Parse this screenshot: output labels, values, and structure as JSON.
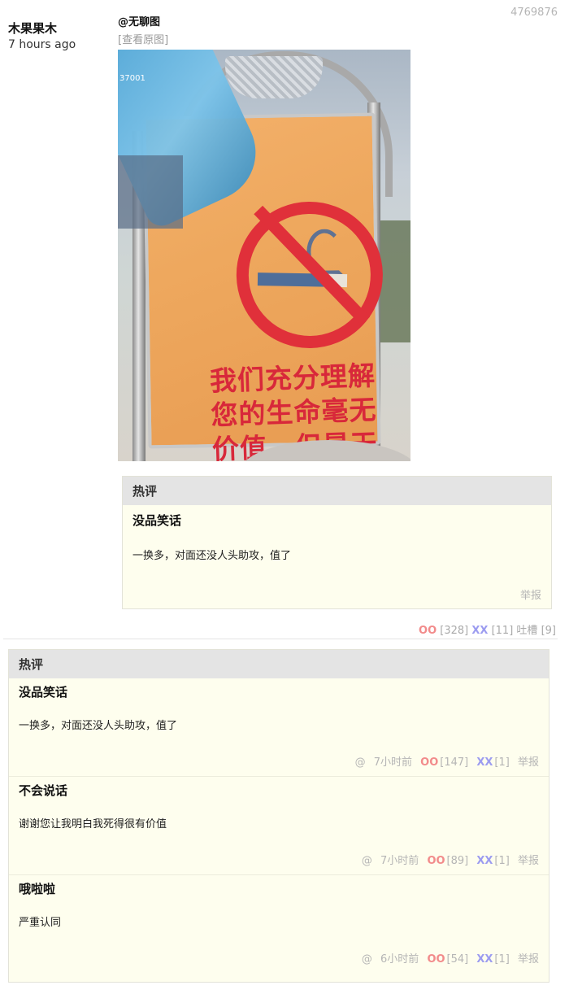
{
  "post": {
    "id": "4769876",
    "author": "木果果木",
    "time": "7 hours ago",
    "mention": "@无聊图",
    "view_original": "[查看原图]",
    "image_text": "我们充分理解您的生命毫无价值，但是天然气真的很贵",
    "image_watermark": "37001"
  },
  "hot_preview": {
    "header": "热评",
    "name": "没品笑话",
    "text": "一换多，对面还没人头助攻，值了",
    "report": "举报"
  },
  "votes": {
    "oo_label": "OO",
    "oo_count": "[328]",
    "xx_label": "XX",
    "xx_count": "[11]",
    "tucao_label": "吐槽",
    "tucao_count": "[9]"
  },
  "comments": {
    "header": "热评",
    "items": [
      {
        "name": "没品笑话",
        "text": "一换多，对面还没人头助攻，值了",
        "at": "@",
        "time": "7小时前",
        "oo": "OO",
        "oo_count": "[147]",
        "xx": "XX",
        "xx_count": "[1]",
        "report": "举报"
      },
      {
        "name": "不会说话",
        "text": "谢谢您让我明白我死得很有价值",
        "at": "@",
        "time": "7小时前",
        "oo": "OO",
        "oo_count": "[89]",
        "xx": "XX",
        "xx_count": "[1]",
        "report": "举报"
      },
      {
        "name": "哦啦啦",
        "text": "严重认同",
        "at": "@",
        "time": "6小时前",
        "oo": "OO",
        "oo_count": "[54]",
        "xx": "XX",
        "xx_count": "[1]",
        "report": "举报"
      }
    ]
  }
}
